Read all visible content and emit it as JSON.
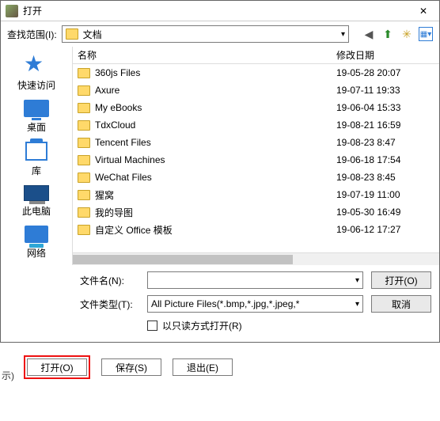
{
  "dialog": {
    "title": "打开",
    "lookInLabel": "查找范围(I):",
    "lookInValue": "文档",
    "fileNameLabel": "文件名(N):",
    "fileNameValue": "",
    "fileTypeLabel": "文件类型(T):",
    "fileTypeValue": "All Picture Files(*.bmp,*.jpg,*.jpeg,*",
    "readOnlyLabel": "以只读方式打开(R)",
    "openBtn": "打开(O)",
    "cancelBtn": "取消",
    "columns": {
      "name": "名称",
      "date": "修改日期"
    }
  },
  "toolbarIcons": {
    "back": "back-icon",
    "up": "up-icon",
    "newFolder": "new-folder-icon",
    "viewMenu": "view-menu-icon"
  },
  "places": [
    {
      "label": "快速访问"
    },
    {
      "label": "桌面"
    },
    {
      "label": "库"
    },
    {
      "label": "此电脑"
    },
    {
      "label": "网络"
    }
  ],
  "files": [
    {
      "name": "360js Files",
      "date": "19-05-28 20:07"
    },
    {
      "name": "Axure",
      "date": "19-07-11 19:33"
    },
    {
      "name": "My eBooks",
      "date": "19-06-04 15:33"
    },
    {
      "name": "TdxCloud",
      "date": "19-08-21 16:59"
    },
    {
      "name": "Tencent Files",
      "date": "19-08-23 8:47"
    },
    {
      "name": "Virtual Machines",
      "date": "19-06-18 17:54"
    },
    {
      "name": "WeChat Files",
      "date": "19-08-23 8:45"
    },
    {
      "name": "猩窝",
      "date": "19-07-19 11:00"
    },
    {
      "name": "我的导图",
      "date": "19-05-30 16:49"
    },
    {
      "name": "自定义 Office 模板",
      "date": "19-06-12 17:27"
    }
  ],
  "bottomButtons": {
    "open": "打开(O)",
    "save": "保存(S)",
    "exit": "退出(E)"
  },
  "hint": "示)"
}
